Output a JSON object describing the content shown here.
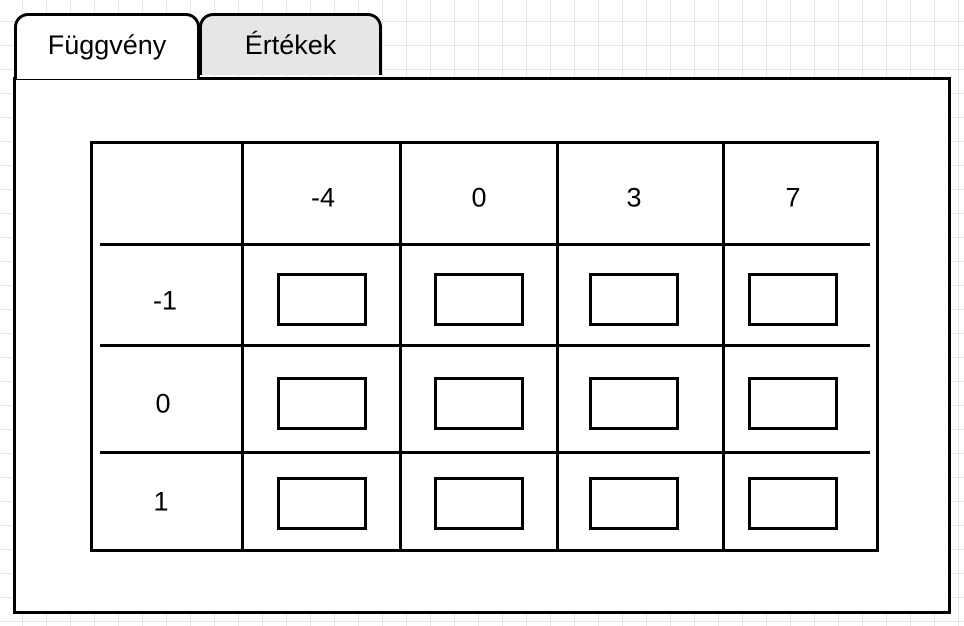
{
  "tabs": [
    {
      "label": "Függvény",
      "active": true
    },
    {
      "label": "Értékek",
      "active": false
    }
  ],
  "table": {
    "column_headers": [
      "-4",
      "0",
      "3",
      "7"
    ],
    "row_headers": [
      "-1",
      "0",
      "1"
    ],
    "cells": [
      [
        "",
        "",
        "",
        ""
      ],
      [
        "",
        "",
        "",
        ""
      ],
      [
        "",
        "",
        "",
        ""
      ]
    ]
  },
  "colors": {
    "border": "#000000",
    "inactive_tab": "#e6e6e6",
    "background_grid": "#e6e6e6"
  }
}
